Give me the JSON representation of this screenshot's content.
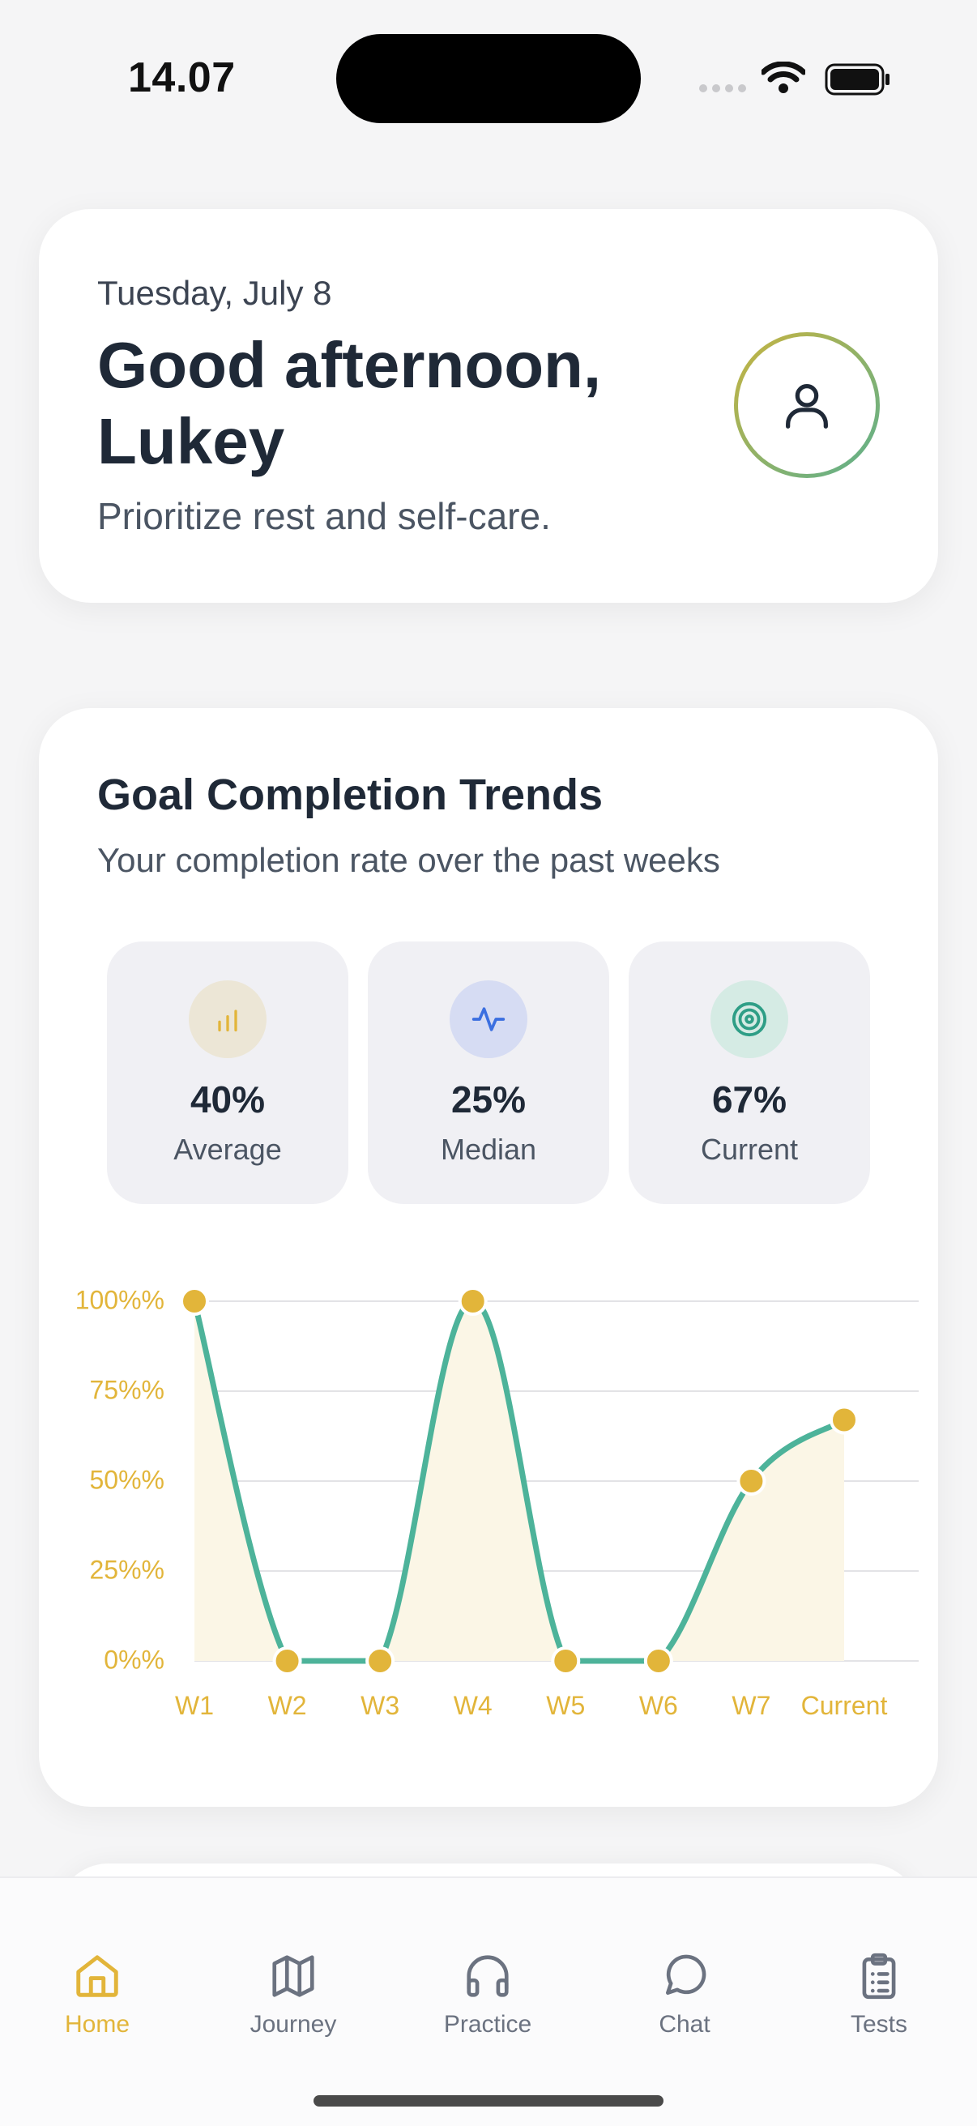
{
  "status_bar": {
    "time": "14.07"
  },
  "greeting_card": {
    "date": "Tuesday, July 8",
    "greeting": "Good afternoon, Lukey",
    "tagline": "Prioritize rest and self-care.",
    "avatar_icon": "user-icon"
  },
  "trends": {
    "title": "Goal Completion Trends",
    "subtitle": "Your completion rate over the past weeks",
    "stats": [
      {
        "icon": "bar-chart-icon",
        "value": "40%",
        "label": "Average",
        "color": "#e2b53a"
      },
      {
        "icon": "activity-icon",
        "value": "25%",
        "label": "Median",
        "color": "#3b6fe0"
      },
      {
        "icon": "target-icon",
        "value": "67%",
        "label": "Current",
        "color": "#2e9e86"
      }
    ]
  },
  "chart_data": {
    "type": "area",
    "categories": [
      "W1",
      "W2",
      "W3",
      "W4",
      "W5",
      "W6",
      "W7",
      "Current"
    ],
    "values": [
      100,
      0,
      0,
      100,
      0,
      0,
      50,
      67
    ],
    "ylim": [
      0,
      100
    ],
    "y_ticks": [
      "100%%",
      "75%%",
      "50%%",
      "25%%",
      "0%%"
    ],
    "grid": true,
    "line_color": "#4db39a",
    "point_color": "#e2b53a",
    "fill_color": "#fbf6e6"
  },
  "tab_bar": {
    "tabs": [
      {
        "label": "Home",
        "icon": "home-icon",
        "active": true
      },
      {
        "label": "Journey",
        "icon": "map-icon",
        "active": false
      },
      {
        "label": "Practice",
        "icon": "headphones-icon",
        "active": false
      },
      {
        "label": "Chat",
        "icon": "chat-bubble-icon",
        "active": false
      },
      {
        "label": "Tests",
        "icon": "clipboard-icon",
        "active": false
      }
    ]
  }
}
